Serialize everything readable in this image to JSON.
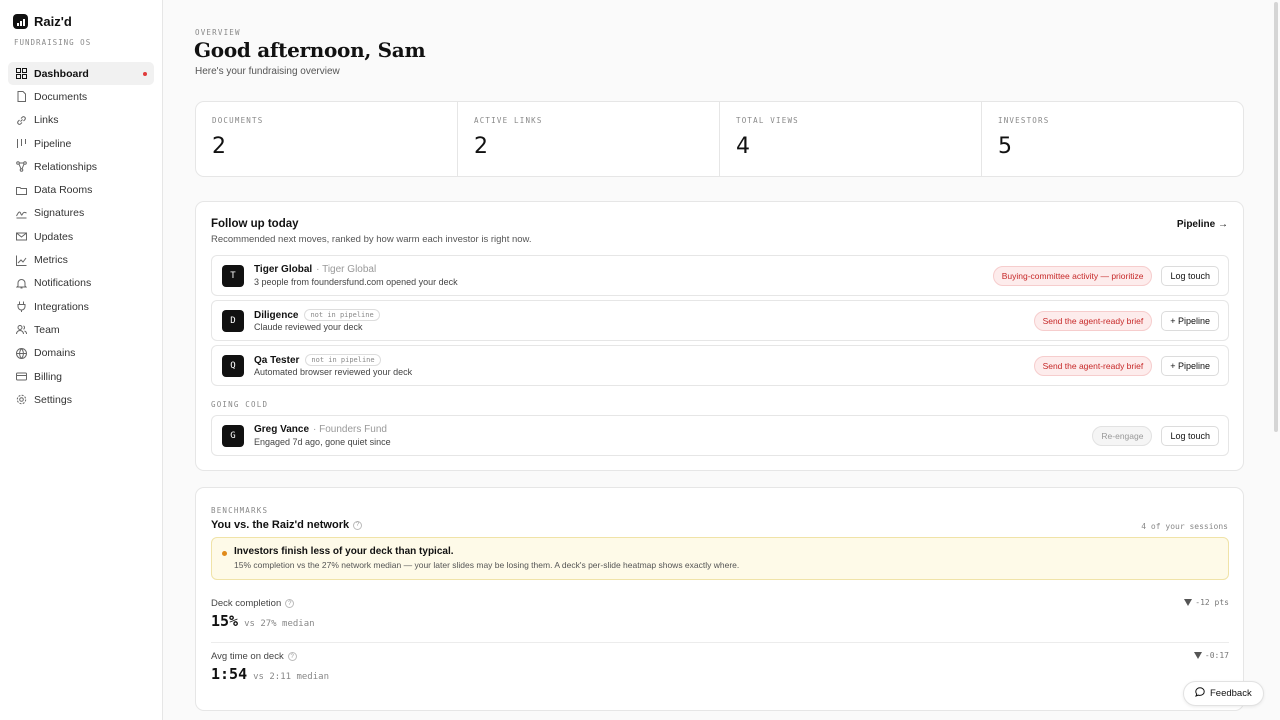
{
  "brand": {
    "name": "Raiz'd",
    "subtitle": "FUNDRAISING OS"
  },
  "sidebar": {
    "items": [
      {
        "label": "Dashboard",
        "icon": "grid-icon",
        "active": true,
        "dot": true
      },
      {
        "label": "Documents",
        "icon": "document-icon"
      },
      {
        "label": "Links",
        "icon": "link-icon"
      },
      {
        "label": "Pipeline",
        "icon": "pipeline-icon"
      },
      {
        "label": "Relationships",
        "icon": "network-icon"
      },
      {
        "label": "Data Rooms",
        "icon": "folder-icon"
      },
      {
        "label": "Signatures",
        "icon": "signature-icon"
      },
      {
        "label": "Updates",
        "icon": "mail-icon"
      },
      {
        "label": "Metrics",
        "icon": "chart-icon"
      },
      {
        "label": "Notifications",
        "icon": "bell-icon"
      },
      {
        "label": "Integrations",
        "icon": "plug-icon"
      },
      {
        "label": "Team",
        "icon": "users-icon"
      },
      {
        "label": "Domains",
        "icon": "globe-icon"
      },
      {
        "label": "Billing",
        "icon": "card-icon"
      },
      {
        "label": "Settings",
        "icon": "gear-icon"
      }
    ]
  },
  "header": {
    "eyebrow": "OVERVIEW",
    "greeting": "Good afternoon, Sam",
    "subtitle": "Here's your fundraising overview"
  },
  "stats": [
    {
      "label": "DOCUMENTS",
      "value": "2"
    },
    {
      "label": "ACTIVE LINKS",
      "value": "2"
    },
    {
      "label": "TOTAL VIEWS",
      "value": "4"
    },
    {
      "label": "INVESTORS",
      "value": "5"
    }
  ],
  "follow_up": {
    "title": "Follow up today",
    "subtitle": "Recommended next moves, ranked by how warm each investor is right now.",
    "link": "Pipeline →",
    "going_cold_label": "GOING COLD",
    "rows": [
      {
        "initial": "T",
        "name": "Tiger Global",
        "firm": "· Tiger Global",
        "tag": "",
        "desc": "3 people from foundersfund.com opened your deck",
        "pill": "Buying-committee activity — prioritize",
        "pill_style": "red",
        "action": "Log touch"
      },
      {
        "initial": "D",
        "name": "Diligence",
        "firm": "",
        "tag": "not in pipeline",
        "desc": "Claude reviewed your deck",
        "pill": "Send the agent-ready brief",
        "pill_style": "red",
        "action": "+ Pipeline"
      },
      {
        "initial": "Q",
        "name": "Qa Tester",
        "firm": "",
        "tag": "not in pipeline",
        "desc": "Automated browser reviewed your deck",
        "pill": "Send the agent-ready brief",
        "pill_style": "red",
        "action": "+ Pipeline"
      },
      {
        "initial": "G",
        "name": "Greg Vance",
        "firm": "· Founders Fund",
        "tag": "",
        "desc": "Engaged 7d ago, gone quiet since",
        "pill": "Re-engage",
        "pill_style": "grey",
        "action": "Log touch"
      }
    ]
  },
  "benchmarks": {
    "eyebrow": "BENCHMARKS",
    "title": "You vs. the Raiz'd network",
    "sessions": "4 of your sessions",
    "alert_title": "Investors finish less of your deck than typical.",
    "alert_text": "15% completion vs the 27% network median — your later slides may be losing them. A deck's per-slide heatmap shows exactly where.",
    "metrics": [
      {
        "name": "Deck completion",
        "value": "15%",
        "median": "vs 27% median",
        "delta": "-12 pts"
      },
      {
        "name": "Avg time on deck",
        "value": "1:54",
        "median": "vs 2:11 median",
        "delta": "-0:17"
      }
    ]
  },
  "feedback": {
    "label": "Feedback"
  },
  "colors": {
    "accent_red": "#c62828",
    "alert_bg": "#fefae8",
    "brand": "#111111"
  }
}
